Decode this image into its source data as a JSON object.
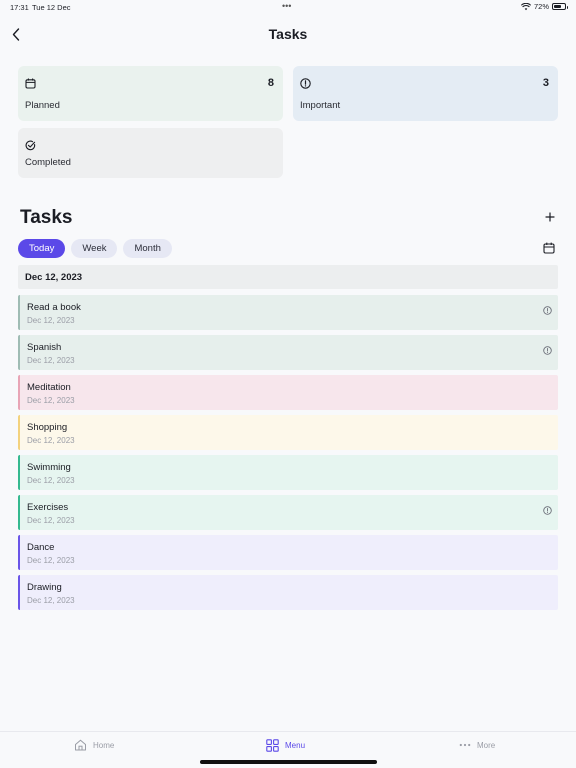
{
  "status_bar": {
    "time": "17:31",
    "date": "Tue 12 Dec",
    "battery": "72%",
    "battery_level": 0.72
  },
  "header": {
    "title": "Tasks",
    "back_icon": "chevron-left-icon"
  },
  "cards": [
    {
      "label": "Planned",
      "count": "8",
      "icon": "calendar-icon",
      "bg": "#eaf2ee"
    },
    {
      "label": "Important",
      "count": "3",
      "icon": "alert-circle-icon",
      "bg": "#e4ecf4"
    },
    {
      "label": "Completed",
      "count": "",
      "icon": "check-circle-icon",
      "bg": "#eeeff0"
    }
  ],
  "section": {
    "title": "Tasks",
    "add_icon": "plus-icon",
    "calendar_icon": "calendar-icon"
  },
  "filters": [
    {
      "label": "Today",
      "active": true
    },
    {
      "label": "Week",
      "active": false
    },
    {
      "label": "Month",
      "active": false
    }
  ],
  "date_header": "Dec 12, 2023",
  "tasks": [
    {
      "title": "Read a book",
      "date": "Dec 12, 2023",
      "important": true,
      "accent": "#9fbcb4",
      "bg": "#e6efec"
    },
    {
      "title": "Spanish",
      "date": "Dec 12, 2023",
      "important": true,
      "accent": "#9fbcb4",
      "bg": "#e6efec"
    },
    {
      "title": "Meditation",
      "date": "Dec 12, 2023",
      "important": false,
      "accent": "#e8a5b6",
      "bg": "#f7e6ec"
    },
    {
      "title": "Shopping",
      "date": "Dec 12, 2023",
      "important": false,
      "accent": "#f3d27e",
      "bg": "#fdf8ea"
    },
    {
      "title": "Swimming",
      "date": "Dec 12, 2023",
      "important": false,
      "accent": "#35b98f",
      "bg": "#e6f5f0"
    },
    {
      "title": "Exercises",
      "date": "Dec 12, 2023",
      "important": true,
      "accent": "#35b98f",
      "bg": "#e6f5f0"
    },
    {
      "title": "Dance",
      "date": "Dec 12, 2023",
      "important": false,
      "accent": "#6a55e8",
      "bg": "#efeefc"
    },
    {
      "title": "Drawing",
      "date": "Dec 12, 2023",
      "important": false,
      "accent": "#6a55e8",
      "bg": "#efeefc"
    }
  ],
  "bottom_nav": [
    {
      "label": "Home",
      "icon": "home-icon",
      "active": false
    },
    {
      "label": "Menu",
      "icon": "grid-icon",
      "active": true
    },
    {
      "label": "More",
      "icon": "more-horizontal-icon",
      "active": false
    }
  ],
  "colors": {
    "accent": "#5b49e8",
    "background": "#f8f9fb"
  }
}
